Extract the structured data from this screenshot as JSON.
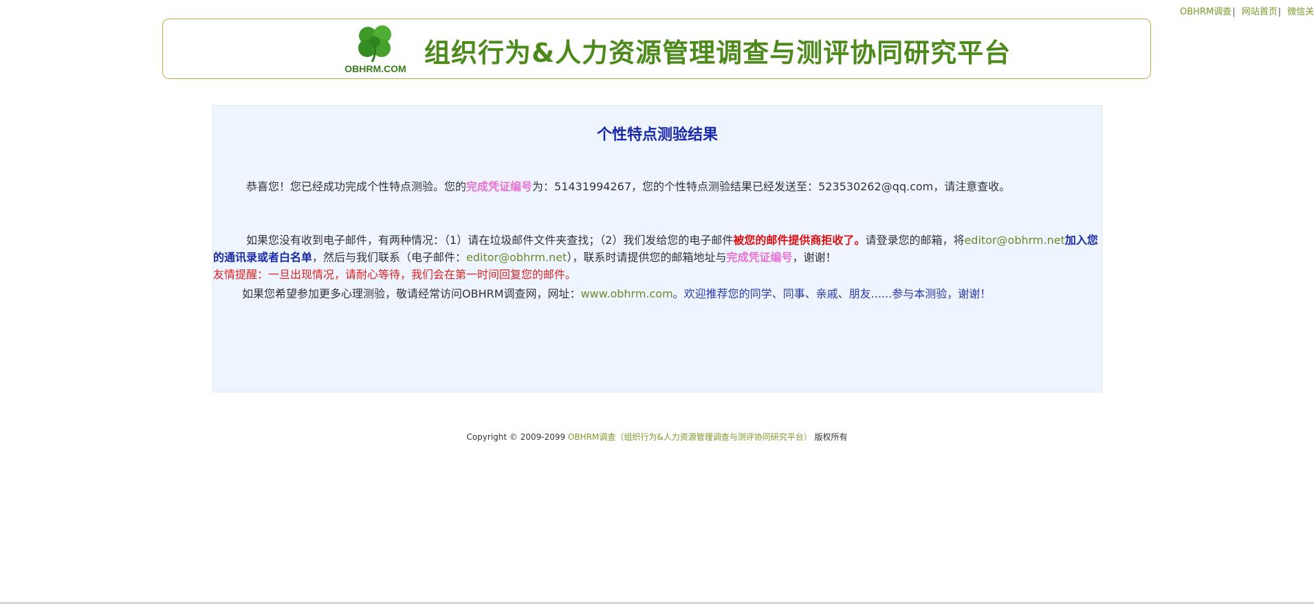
{
  "top_links": [
    {
      "label": "OBHRM调查"
    },
    {
      "label": "网站首页"
    },
    {
      "label": "微信关注"
    }
  ],
  "top_link_separator": "|",
  "banner": {
    "logo_text": "OBHRM.COM",
    "title": "组织行为&人力资源管理调查与测评协同研究平台"
  },
  "result": {
    "title": "个性特点测验结果",
    "p1": {
      "a": "恭喜您！您已经成功完成个性特点测验。您的",
      "cert_label": "完成凭证编号",
      "b": "为：",
      "cert_number": "51431994267",
      "c": "，您的个性特点测验结果已经发送至：",
      "email": "523530262@qq.com",
      "d": "，请注意查收。"
    },
    "p2": {
      "a": "如果您没有收到电子邮件，有两种情况：（",
      "n1": "1",
      "b": "）请在垃圾邮件文件夹查找；（",
      "n2": "2",
      "c": "）我们发给您的电子邮件",
      "rejected": "被您的邮件提供商拒收了。",
      "d": "请登录您的邮箱，将",
      "editor_email": "editor@obhrm.net",
      "add_contact": "加入您的通讯录或者白名单",
      "e": "，然后与我们联系（电子邮件：",
      "editor_email2": "editor@obhrm.net",
      "f": "），联系时请提供您的邮箱地址与",
      "cert_label": "完成凭证编号",
      "g": "，谢谢！",
      "tip": "友情提醒：一旦出现情况，请耐心等待，我们会在第一时间回复您的邮件。"
    },
    "p3": {
      "a": "如果您希望参加更多心理测验，敬请经常访问",
      "brand": "OBHRM",
      "b": "调查网，网址：",
      "url": "www.obhrm.com",
      "c": "。欢迎推荐您的同学、同事、亲戚、朋友......参与本测验，谢谢！"
    }
  },
  "footer": {
    "copyright": "Copyright © 2009-2099 ",
    "link": "OBHRM调查（组织行为&人力资源管理调查与测评协同研究平台）",
    "rights": " 版权所有"
  },
  "colors": {
    "brand_green": "#4d8a1c",
    "link_green": "#7a9a2a",
    "title_blue": "#1a2aa8",
    "highlight_pink": "#e872d4",
    "alert_red": "#dd1111",
    "box_bg": "#eef5fe"
  }
}
